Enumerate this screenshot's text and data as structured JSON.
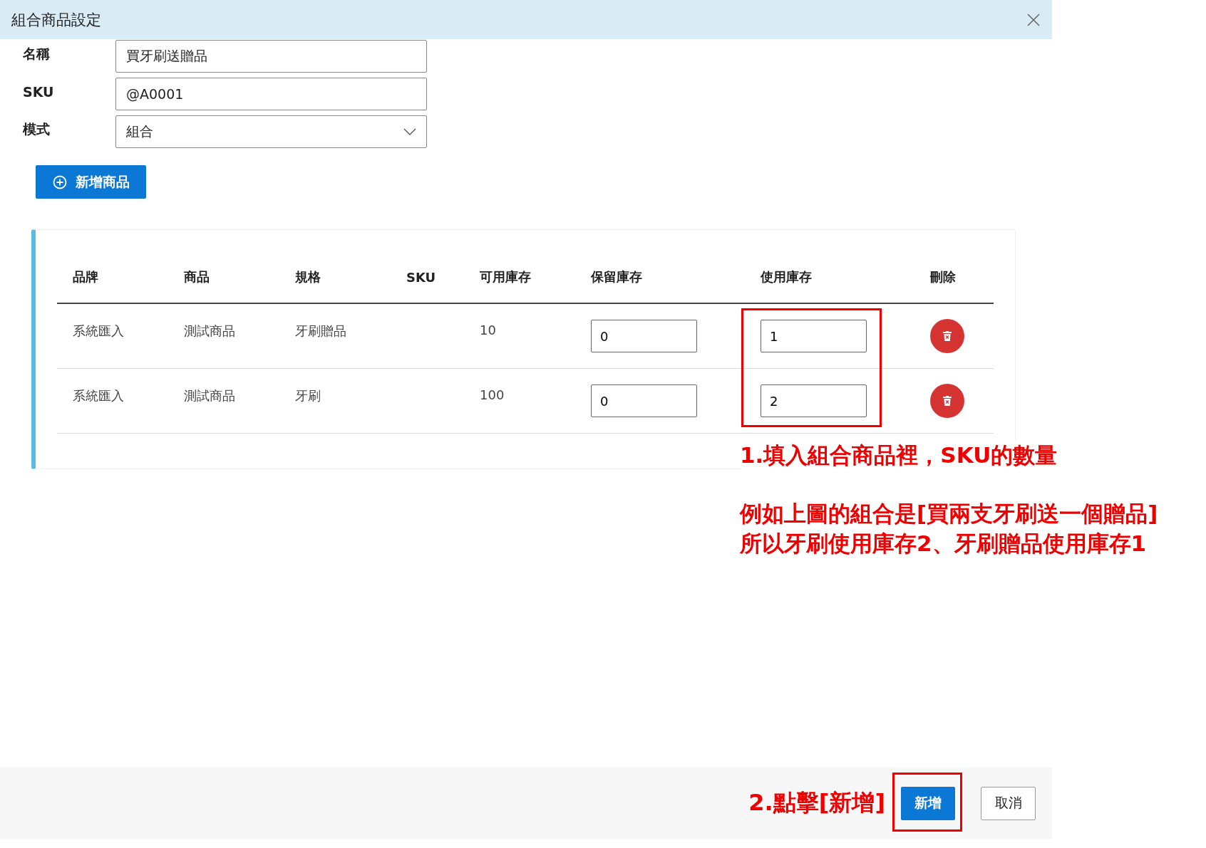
{
  "dialog": {
    "title": "組合商品設定"
  },
  "form": {
    "fields": [
      {
        "kind": "text",
        "label": "名稱",
        "value": "買牙刷送贈品"
      },
      {
        "kind": "text",
        "label": "SKU",
        "value": "@A0001"
      },
      {
        "kind": "select",
        "label": "模式",
        "value": "組合"
      }
    ]
  },
  "add_item_button": "新增商品",
  "table": {
    "columns": [
      "品牌",
      "商品",
      "規格",
      "SKU",
      "可用庫存",
      "保留庫存",
      "使用庫存",
      "刪除"
    ],
    "rows": [
      {
        "brand": "系統匯入",
        "product": "測試商品",
        "spec": "牙刷贈品",
        "available": "10",
        "reserved": "0",
        "used": "1"
      },
      {
        "brand": "系統匯入",
        "product": "測試商品",
        "spec": "牙刷",
        "available": "100",
        "reserved": "0",
        "used": "2"
      }
    ]
  },
  "annotations": [
    {
      "lines": [
        "1.填入組合商品裡，SKU的數量"
      ]
    },
    {
      "lines": [
        "例如上圖的組合是[買兩支牙刷送一個贈品]",
        "所以牙刷使用庫存2、牙刷贈品使用庫存1"
      ]
    }
  ],
  "footer": {
    "note": "2.點擊[新增]",
    "buttons": [
      {
        "kind": "primary",
        "label": "新增"
      },
      {
        "kind": "secondary",
        "label": "取消"
      }
    ]
  }
}
